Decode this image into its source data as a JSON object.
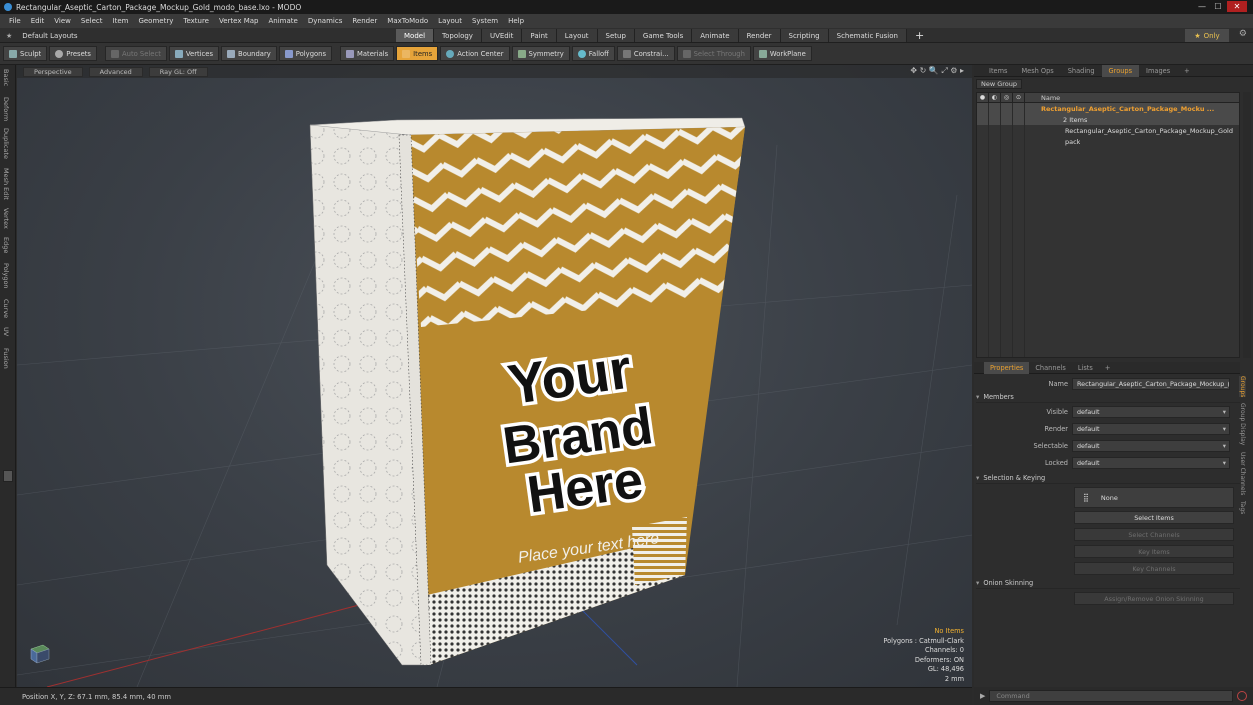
{
  "window": {
    "title": "Rectangular_Aseptic_Carton_Package_Mockup_Gold_modo_base.lxo - MODO",
    "min_label": "—",
    "max_label": "☐",
    "close_label": "✕"
  },
  "menu": [
    "File",
    "Edit",
    "View",
    "Select",
    "Item",
    "Geometry",
    "Texture",
    "Vertex Map",
    "Animate",
    "Dynamics",
    "Render",
    "MaxToModo",
    "Layout",
    "System",
    "Help"
  ],
  "layoutbar": {
    "layout_dropdown": "Default Layouts",
    "tabs": [
      "Model",
      "Topology",
      "UVEdit",
      "Paint",
      "Layout",
      "Setup",
      "Game Tools",
      "Animate",
      "Render",
      "Scripting",
      "Schematic Fusion"
    ],
    "active_tab": "Model",
    "plus": "+",
    "only_label": "Only",
    "star": "★",
    "gear": "⚙"
  },
  "toolbar": {
    "sculpt": "Sculpt",
    "presets": "Presets",
    "auto_select": "Auto Select",
    "vertices": "Vertices",
    "boundary": "Boundary",
    "polygons": "Polygons",
    "materials": "Materials",
    "items": "Items",
    "action_center": "Action Center",
    "symmetry": "Symmetry",
    "falloff": "Falloff",
    "constrain": "Constrai...",
    "select_through": "Select Through",
    "workplane": "WorkPlane"
  },
  "left_tabs": [
    "Basic",
    "Deform",
    "Duplicate",
    "Mesh Edit",
    "Vertex",
    "Edge",
    "Polygon",
    "Curve",
    "UV",
    "Fusion"
  ],
  "viewport": {
    "view_mode": "Perspective",
    "shading": "Advanced",
    "raygl": "Ray GL: Off",
    "icons": "✥ ↻ 🔍 ⤢ ⚙ ▸",
    "stats": {
      "no_items": "No Items",
      "polygons": "Polygons : Catmull-Clark",
      "channels": "Channels: 0",
      "deformers": "Deformers: ON",
      "gl": "GL: 48,496",
      "unit": "2 mm"
    },
    "carton_text": {
      "line1": "Your",
      "line2": "Brand",
      "line3": "Here",
      "tagline": "Place your text here"
    },
    "colors": {
      "gold": "#b8892e",
      "white": "#f1efe9"
    }
  },
  "status": {
    "position": "Position X, Y, Z:   67.1 mm, 85.4 mm, 40 mm"
  },
  "right_panel": {
    "tabs": [
      "Items",
      "Mesh Ops",
      "Shading",
      "Groups",
      "Images",
      "+"
    ],
    "active_tab": "Groups",
    "new_group": "New Group",
    "list_header": "Name",
    "rows": [
      {
        "name": "Rectangular_Aseptic_Carton_Package_Mocku ...",
        "sub": "2 Items"
      },
      {
        "name": "Rectangular_Aseptic_Carton_Package_Mockup_Gold"
      },
      {
        "name": "pack"
      }
    ]
  },
  "properties": {
    "tabs": [
      "Properties",
      "Channels",
      "Lists",
      "+"
    ],
    "name_label": "Name",
    "name_value": "Rectangular_Aseptic_Carton_Package_Mockup_(",
    "members": "Members",
    "visible_label": "Visible",
    "visible_value": "default",
    "render_label": "Render",
    "render_value": "default",
    "selectable_label": "Selectable",
    "selectable_value": "default",
    "locked_label": "Locked",
    "locked_value": "default",
    "selection_keying": "Selection & Keying",
    "none_label": "None",
    "select_items": "Select Items",
    "select_channels": "Select Channels",
    "key_items": "Key Items",
    "key_channels": "Key Channels",
    "onion": "Onion Skinning",
    "assign_onion": "Assign/Remove Onion Skinning",
    "side_tabs": [
      "Groups",
      "Group Display",
      "User Channels",
      "Tags"
    ]
  },
  "command": {
    "placeholder": "Command",
    "arrow": "▶"
  }
}
